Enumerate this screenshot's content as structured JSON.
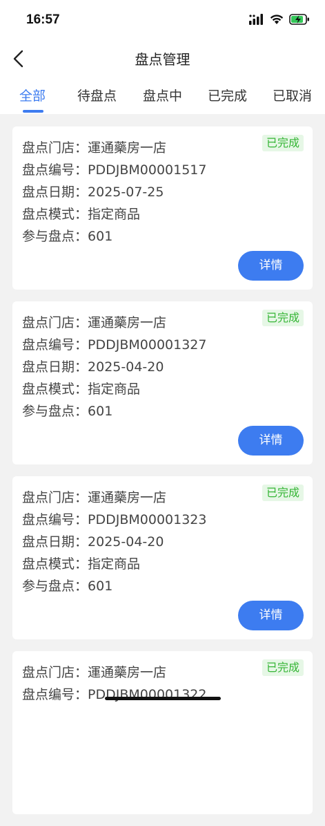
{
  "status_bar": {
    "time": "16:57"
  },
  "nav": {
    "title": "盘点管理"
  },
  "tabs": [
    {
      "label": "全部",
      "active": true
    },
    {
      "label": "待盘点",
      "active": false
    },
    {
      "label": "盘点中",
      "active": false
    },
    {
      "label": "已完成",
      "active": false
    },
    {
      "label": "已取消",
      "active": false
    }
  ],
  "labels": {
    "store": "盘点门店：",
    "number": "盘点编号：",
    "date": "盘点日期：",
    "mode": "盘点模式：",
    "participate": "参与盘点："
  },
  "detail_button": "详情",
  "records": [
    {
      "status": "已完成",
      "store": "運通藥房一店",
      "number": "PDDJBM00001517",
      "date": "2025-07-25",
      "mode": "指定商品",
      "participate": "601"
    },
    {
      "status": "已完成",
      "store": "運通藥房一店",
      "number": "PDDJBM00001327",
      "date": "2025-04-20",
      "mode": "指定商品",
      "participate": "601"
    },
    {
      "status": "已完成",
      "store": "運通藥房一店",
      "number": "PDDJBM00001323",
      "date": "2025-04-20",
      "mode": "指定商品",
      "participate": "601"
    },
    {
      "status": "已完成",
      "store": "運通藥房一店",
      "number": "PDDJBM00001322"
    }
  ],
  "colors": {
    "accent": "#3d7cf0",
    "success_text": "#35b535",
    "success_bg": "#e6f7e6",
    "background": "#f2f2f2"
  },
  "icons": [
    "signal-icon",
    "wifi-icon",
    "battery-charging-icon",
    "back-icon"
  ]
}
